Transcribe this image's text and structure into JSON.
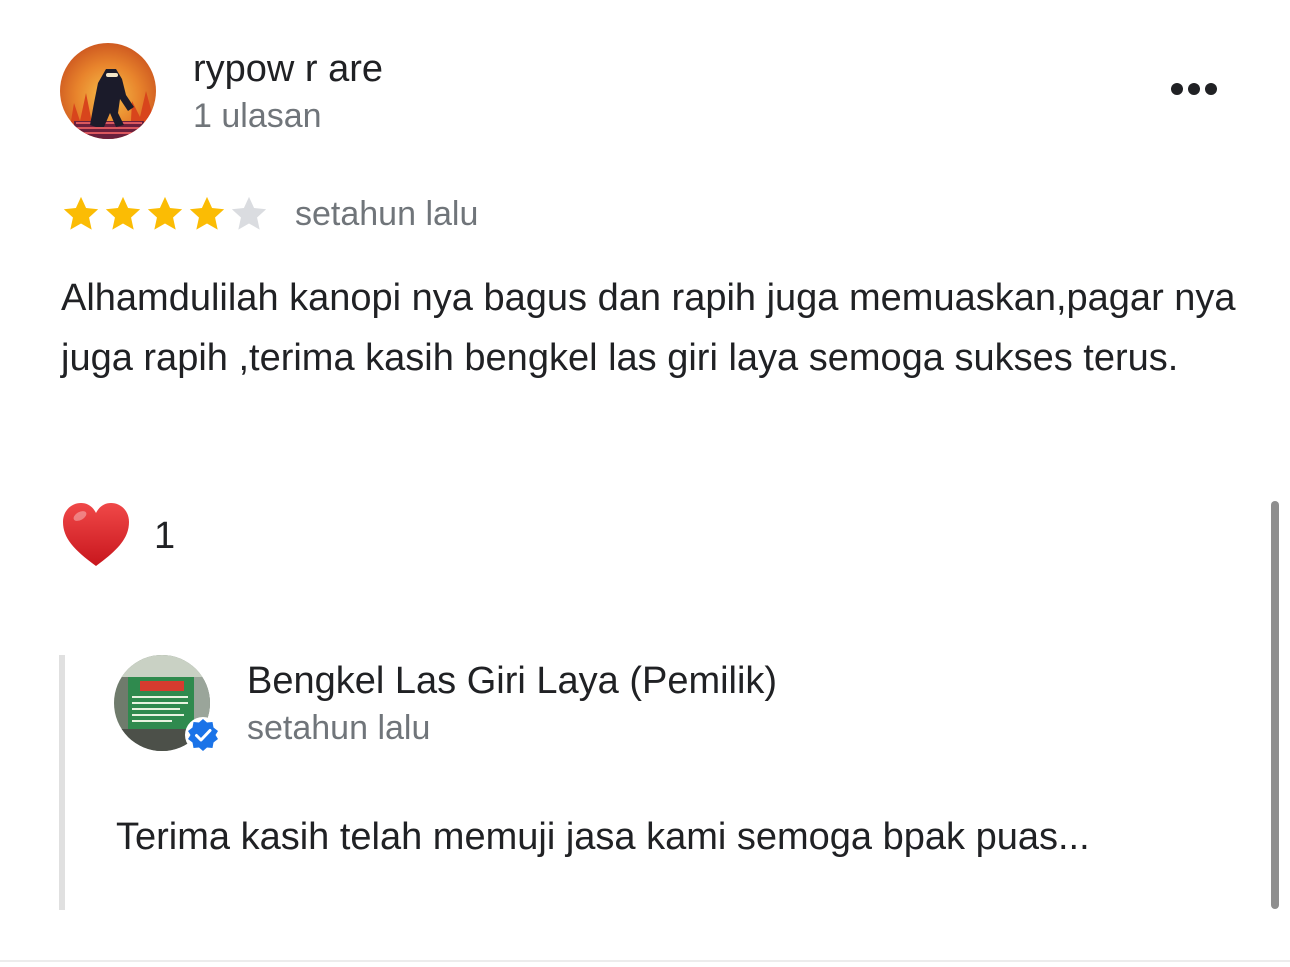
{
  "review": {
    "reviewer_name": "rypow r are",
    "reviewer_meta": "1 ulasan",
    "rating": 4,
    "rating_max": 5,
    "time": "setahun lalu",
    "text": "Alhamdulilah kanopi nya bagus dan rapih juga memuaskan,pagar nya juga rapih ,terima kasih bengkel las giri laya semoga sukses terus.",
    "reaction_count": "1",
    "reaction_icon": "heart-icon",
    "more_icon": "more-horizontal-icon"
  },
  "owner_reply": {
    "name": "Bengkel Las Giri Laya (Pemilik)",
    "time": "setahun lalu",
    "text": "Terima kasih telah memuji jasa kami semoga bpak puas...",
    "badge_icon": "verified-check-icon"
  },
  "colors": {
    "star_filled": "#FBBC04",
    "star_empty": "#DADCE0",
    "heart": "#E0242C",
    "verified": "#1A73E8",
    "secondary_text": "#70757A"
  }
}
